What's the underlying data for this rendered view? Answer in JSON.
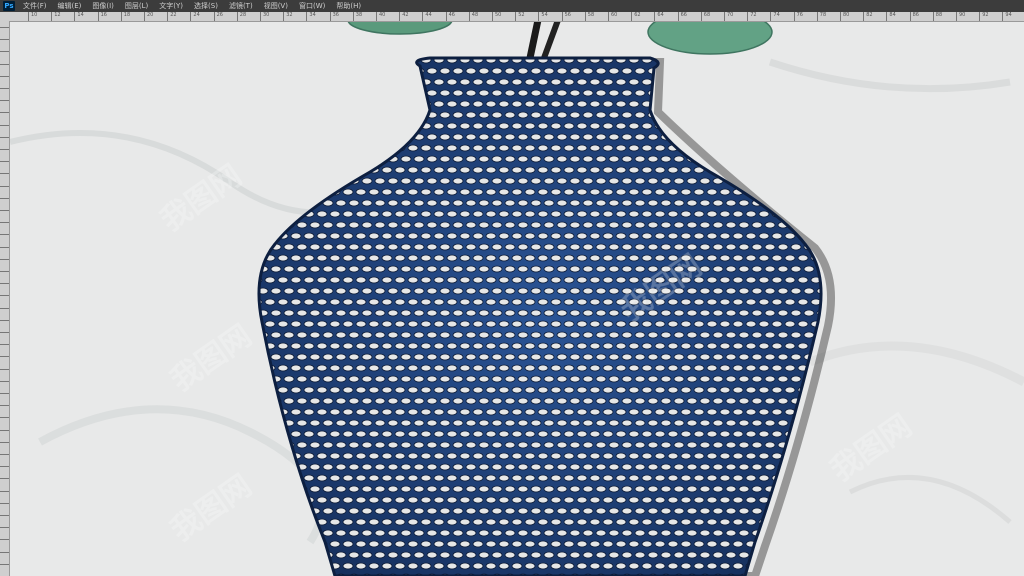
{
  "app": {
    "logo_text": "Ps",
    "accent_color": "#31a8ff"
  },
  "menu": {
    "items": [
      {
        "label": "文件(F)"
      },
      {
        "label": "编辑(E)"
      },
      {
        "label": "图像(I)"
      },
      {
        "label": "图层(L)"
      },
      {
        "label": "文字(Y)"
      },
      {
        "label": "选择(S)"
      },
      {
        "label": "滤镜(T)"
      },
      {
        "label": "视图(V)"
      },
      {
        "label": "窗口(W)"
      },
      {
        "label": "帮助(H)"
      }
    ]
  },
  "ruler": {
    "labels": [
      "10",
      "12",
      "14",
      "16",
      "18",
      "20",
      "22",
      "24",
      "26",
      "28",
      "30",
      "32",
      "34",
      "36",
      "38",
      "40",
      "42",
      "44",
      "46",
      "48",
      "50",
      "52",
      "54",
      "56",
      "58",
      "60",
      "62",
      "64",
      "66",
      "68",
      "70",
      "72",
      "74",
      "76",
      "78",
      "80",
      "82",
      "84",
      "86",
      "88",
      "90",
      "92",
      "94",
      "96"
    ]
  },
  "canvas": {
    "background_color": "#e8e9e9",
    "vase_color": "#1f3f78",
    "leaf_color": "#5a9a7c",
    "watermark_text": "我图网"
  }
}
